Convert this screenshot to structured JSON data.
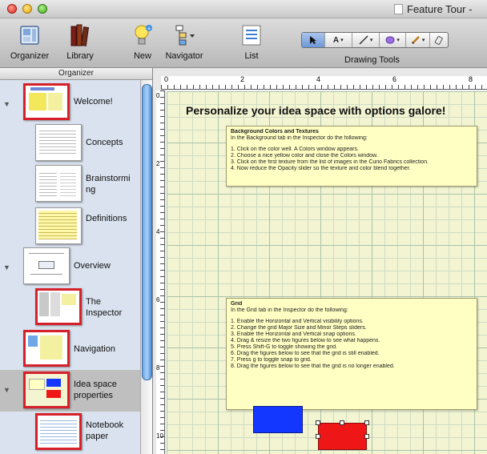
{
  "window": {
    "title": "Feature Tour -"
  },
  "toolbar": {
    "organizer": "Organizer",
    "library": "Library",
    "new": "New",
    "navigator": "Navigator",
    "list": "List",
    "drawing_tools": "Drawing Tools"
  },
  "sidebar": {
    "header": "Organizer",
    "items": [
      {
        "label": "Welcome!"
      },
      {
        "label": "Concepts"
      },
      {
        "label": "Brainstormi ng"
      },
      {
        "label": "Definitions"
      },
      {
        "label": "Overview"
      },
      {
        "label": "The Inspector"
      },
      {
        "label": "Navigation"
      },
      {
        "label": "Idea space properties"
      },
      {
        "label": "Notebook paper"
      }
    ]
  },
  "rulers": {
    "top": [
      "0",
      "2",
      "4",
      "6",
      "8"
    ],
    "left": [
      "0",
      "2",
      "4",
      "6",
      "8",
      "10"
    ]
  },
  "canvas": {
    "heading": "Personalize your idea space with options galore!",
    "note1": {
      "title": "Background Colors and Textures",
      "lines": [
        "In the Background tab in the Inspector do the following:",
        "",
        "1. Click on the color well. A Colors window appears.",
        "2. Choose a nice yellow color and close the Colors window.",
        "3. Click on the first texture from the list of images in the Curio Fabrics collection.",
        "4. Now reduce the Opacity slider so the texture and color blend together."
      ]
    },
    "note2": {
      "title": "Grid",
      "lines": [
        "In the Grid tab in the Inspector do the following:",
        "",
        "1. Enable the Horizontal and Vertical visibility options.",
        "2. Change the grid Major Size and Minor Steps sliders.",
        "3. Enable the Horizontal and Vertical snap options.",
        "4. Drag & resize the two figures below to see what happens.",
        "5. Press Shift-G to toggle showing the grid.",
        "6. Drag the figures below to see that the grid is still enabled.",
        "7. Press g to toggle snap to grid.",
        "8. Drag the figures below to see that the grid is no longer enabled."
      ]
    }
  },
  "colors": {
    "accent_red": "#d6202a",
    "blue_figure": "#1437ff",
    "red_figure": "#ee1616",
    "grid_paper": "#f3f4d2"
  }
}
